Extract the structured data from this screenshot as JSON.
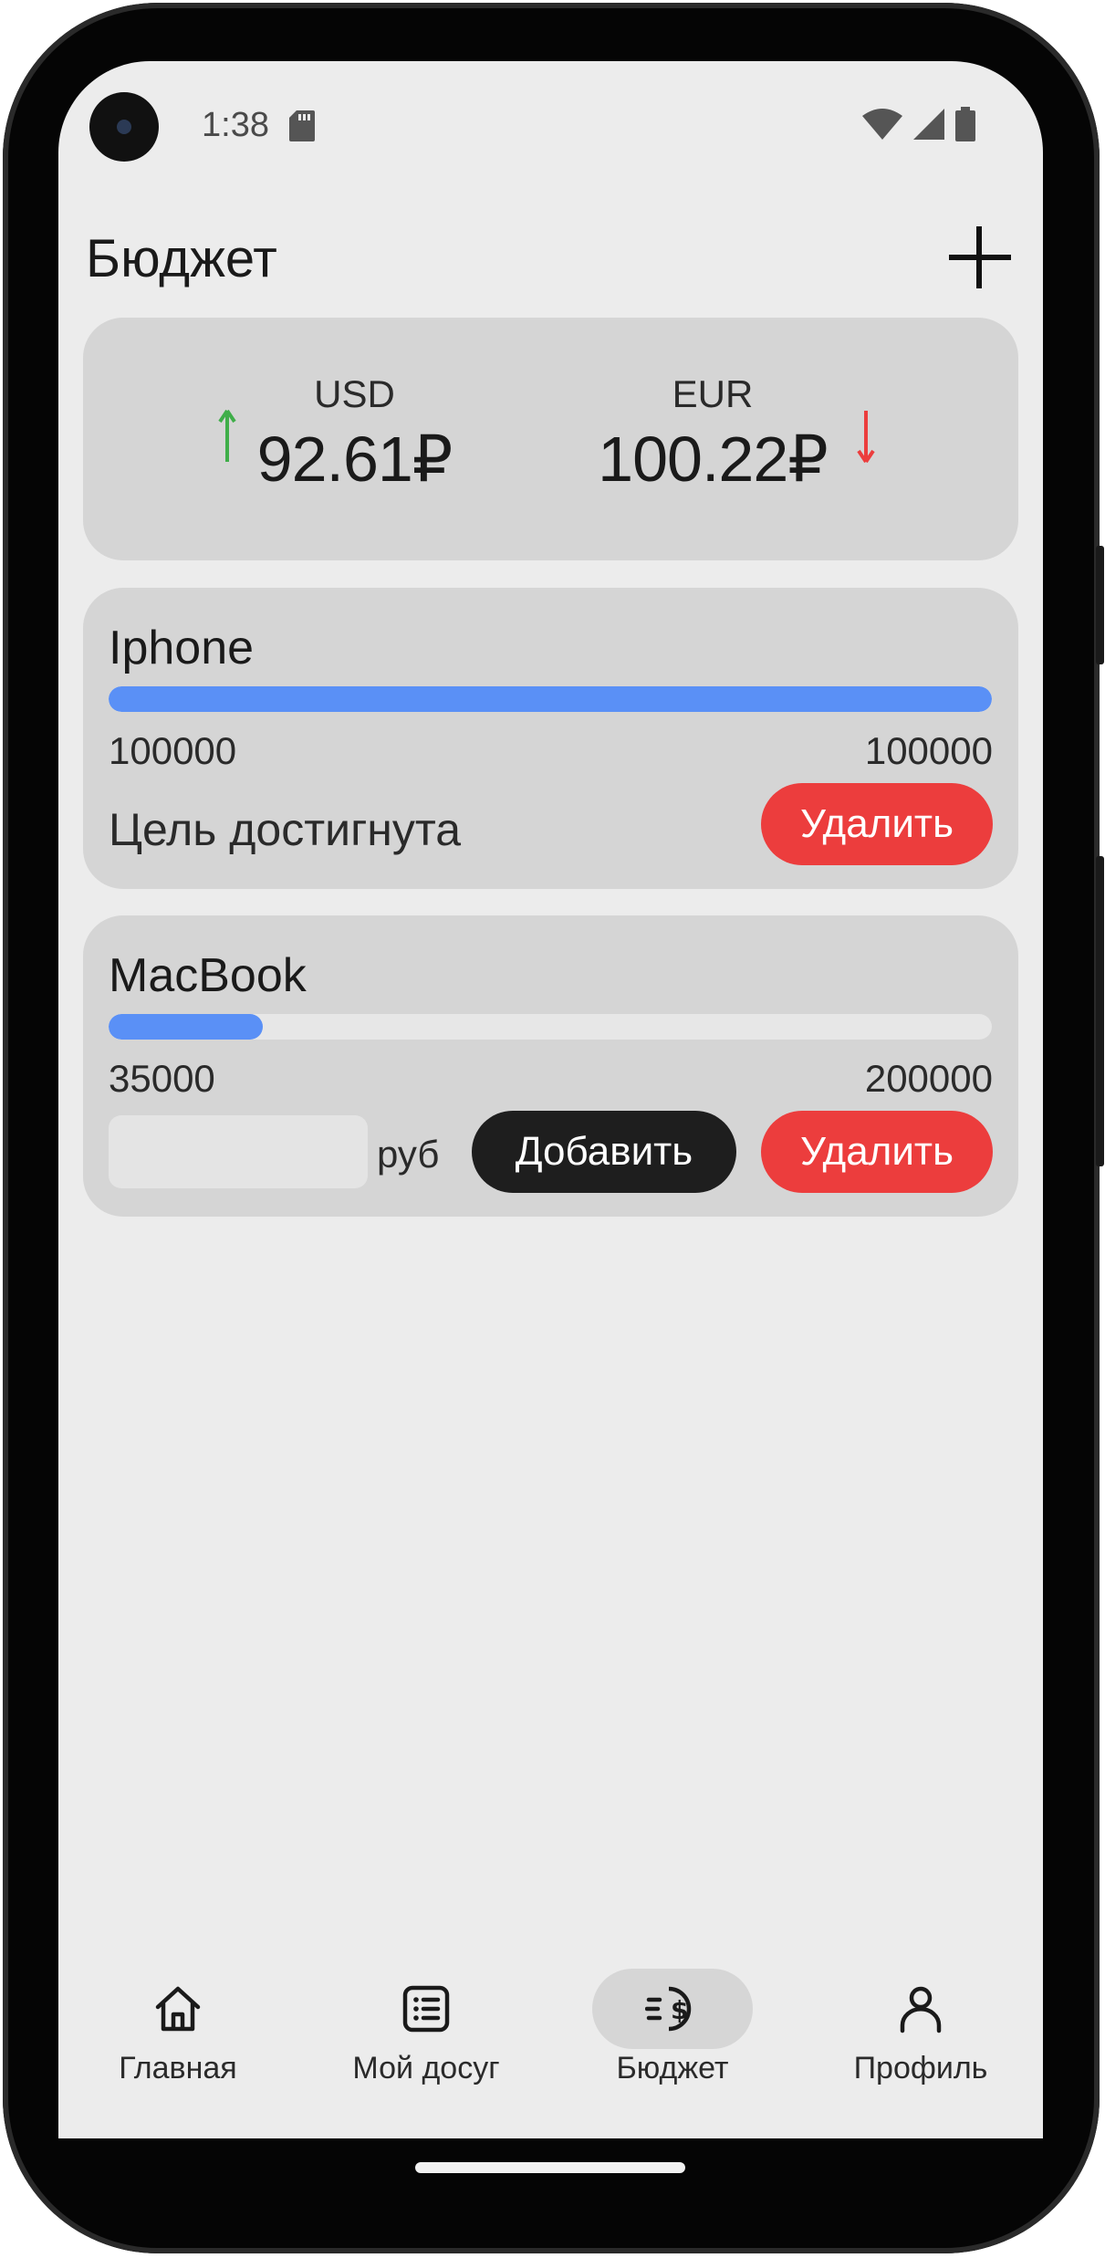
{
  "status_bar": {
    "time": "1:38"
  },
  "header": {
    "title": "Бюджет"
  },
  "rates": [
    {
      "code": "USD",
      "value": "92.61₽",
      "trend": "up",
      "trend_color": "#3fae49"
    },
    {
      "code": "EUR",
      "value": "100.22₽",
      "trend": "down",
      "trend_color": "#ec3d3d"
    }
  ],
  "goals": [
    {
      "name": "Iphone",
      "current": "100000",
      "target": "100000",
      "progress": 1.0,
      "status": "Цель достигнута",
      "delete_label": "Удалить"
    },
    {
      "name": "MacBook",
      "current": "35000",
      "target": "200000",
      "progress": 0.175,
      "amount_value": "",
      "currency": "руб",
      "add_label": "Добавить",
      "delete_label": "Удалить"
    }
  ],
  "nav": [
    {
      "label": "Главная",
      "icon": "home-icon",
      "active": false
    },
    {
      "label": "Мой досуг",
      "icon": "list-icon",
      "active": false
    },
    {
      "label": "Бюджет",
      "icon": "budget-icon",
      "active": true
    },
    {
      "label": "Профиль",
      "icon": "person-icon",
      "active": false
    }
  ],
  "colors": {
    "accent_blue": "#5a90f6",
    "delete_red": "#ec3d3d",
    "up_green": "#3fae49"
  }
}
